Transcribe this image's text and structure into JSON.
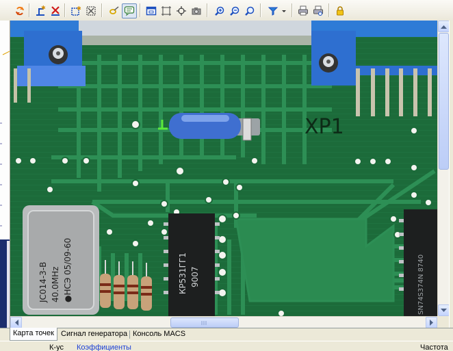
{
  "toolbar": {
    "buttons": [
      {
        "id": "refresh",
        "icon": "refresh-icon"
      },
      {
        "id": "add-marker",
        "icon": "add-marker-icon"
      },
      {
        "id": "delete-marker",
        "icon": "delete-marker-icon"
      },
      {
        "id": "add-region",
        "icon": "add-region-icon"
      },
      {
        "id": "delete-region",
        "icon": "delete-region-icon"
      },
      {
        "id": "link",
        "icon": "link-icon"
      },
      {
        "id": "comment",
        "icon": "comment-icon"
      },
      {
        "id": "fit-window",
        "icon": "fit-window-icon"
      },
      {
        "id": "select-area",
        "icon": "select-area-icon"
      },
      {
        "id": "move",
        "icon": "move-icon"
      },
      {
        "id": "camera",
        "icon": "camera-icon"
      },
      {
        "id": "zoom-in",
        "icon": "zoom-in-icon"
      },
      {
        "id": "zoom-out",
        "icon": "zoom-out-icon"
      },
      {
        "id": "zoom-actual",
        "icon": "zoom-actual-icon"
      },
      {
        "id": "filter",
        "icon": "filter-icon"
      },
      {
        "id": "print",
        "icon": "print-icon"
      },
      {
        "id": "print-preview",
        "icon": "print-preview-icon"
      },
      {
        "id": "lock",
        "icon": "lock-icon"
      }
    ]
  },
  "board": {
    "crystal_lines": [
      "ЈС014-3-В",
      "40.0MHz",
      "●НСЭ 05/09-60"
    ],
    "chip_label_lines": [
      "КР531ГГ1",
      "9007"
    ],
    "chip_right_label": "SN74S374N 8740",
    "connector_label": "ХР1"
  },
  "tabs": {
    "map": "Карта точек",
    "generator": "Сигнал генератора",
    "console": "Консоль MACS"
  },
  "bottom_panel": {
    "left_label": "К-ус",
    "link_label": "Коэффициенты",
    "right_label": "Частота"
  },
  "colors": {
    "pcb": "#1c6b3a",
    "trace": "#2d8f55",
    "blue_component": "#3f6fd0",
    "marker": "#5bea3a"
  }
}
